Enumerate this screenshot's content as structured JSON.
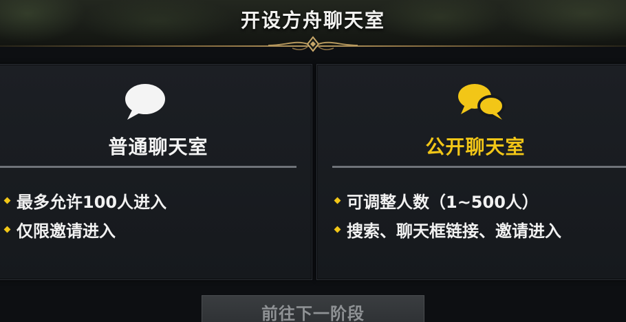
{
  "header": {
    "title": "开设方舟聊天室"
  },
  "rooms": [
    {
      "title": "普通聊天室",
      "icon": "speech-bubble-icon",
      "title_color": "#f3f3f3",
      "features": [
        "最多允许100人进入",
        "仅限邀请进入"
      ]
    },
    {
      "title": "公开聊天室",
      "icon": "double-speech-bubble-icon",
      "title_color": "#f2c617",
      "features": [
        "可调整人数（1~500人）",
        "搜索、聊天框链接、邀请进入"
      ]
    }
  ],
  "footer": {
    "next_label": "前往下一阶段"
  },
  "colors": {
    "accent_gold": "#f2c617",
    "bullet": "#f2c617"
  }
}
